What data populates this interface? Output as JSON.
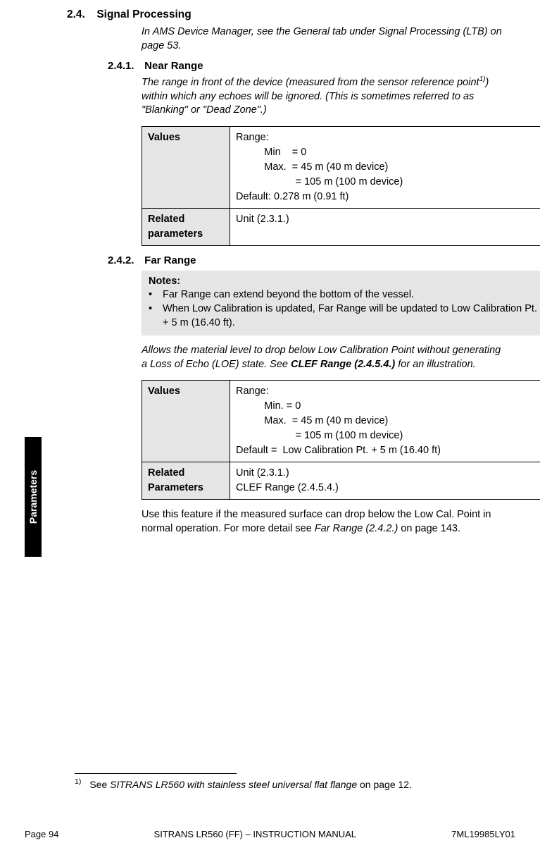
{
  "sideTab": "Parameters",
  "s24": {
    "num": "2.4.",
    "title": "Signal Processing",
    "intro": "In AMS Device Manager, see the General tab under Signal Processing (LTB) on page 53."
  },
  "s241": {
    "num": "2.4.1.",
    "title": "Near Range",
    "intro_pre": "The range in front of the device (measured from the sensor reference point",
    "intro_sup": "1)",
    "intro_post": ") within which any echoes will be ignored. (This is sometimes referred to as \"Blanking\" or \"Dead Zone\".)",
    "tbl": {
      "valuesLabel": "Values",
      "rangeText": "Range:\n          Min    = 0\n          Max.  = 45 m (40 m device)\n                     = 105 m (100 m device)\nDefault: 0.278 m (0.91 ft)",
      "relatedLabel": "Related parameters",
      "relatedText": "Unit (2.3.1.)"
    }
  },
  "s242": {
    "num": "2.4.2.",
    "title": "Far Range",
    "notesTitle": "Notes:",
    "note1": "Far Range can extend beyond the bottom of the vessel.",
    "note2": "When Low Calibration is updated, Far Range will be updated to Low Calibration Pt. + 5 m (16.40 ft).",
    "intro_pre": "Allows the material level to drop below Low Calibration Point without generating a Loss of Echo (LOE) state. See ",
    "intro_bold": "CLEF Range (2.4.5.4.)",
    "intro_post": " for an illustration.",
    "tbl": {
      "valuesLabel": "Values",
      "rangeText": "Range:\n          Min. = 0\n          Max.  = 45 m (40 m device)\n                     = 105 m (100 m device)\nDefault =  Low Calibration Pt. + 5 m (16.40 ft)",
      "relatedLabel": "Related Parameters",
      "relatedText": "Unit (2.3.1.)\nCLEF Range (2.4.5.4.)"
    },
    "after_pre": "Use this feature if the measured surface can drop below the Low Cal. Point in normal operation. For more detail see ",
    "after_italic": "Far Range (2.4.2.) ",
    "after_post": " on page 143."
  },
  "footnote": {
    "num": "1)",
    "pre": "See ",
    "italic": "SITRANS LR560 with stainless steel universal flat flange ",
    "post": " on page 12."
  },
  "footer": {
    "page": "Page 94",
    "title": "SITRANS LR560 (FF) – INSTRUCTION MANUAL",
    "doc": "7ML19985LY01"
  }
}
